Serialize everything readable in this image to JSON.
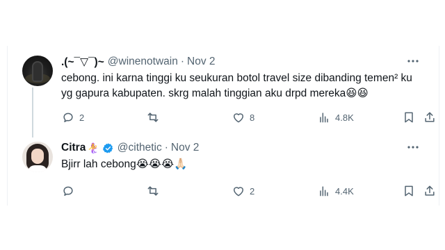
{
  "tweets": [
    {
      "display_name": ".(~¯▽¯)~",
      "handle": "@winenotwain",
      "separator": "·",
      "date": "Nov 2",
      "text": "cebong. ini karna tinggi ku seukuran botol travel size dibanding temen² ku\nyg gapura kabupaten. skrg malah tinggian aku drpd mereka😆😆",
      "replies": "2",
      "retweets": "",
      "likes": "8",
      "views": "4.8K"
    },
    {
      "display_name": "Citra",
      "name_emoji": "🧜‍♀️",
      "verified": true,
      "handle": "@cithetic",
      "separator": "·",
      "date": "Nov 2",
      "text": "Bjirr lah cebong😭😭😭🙏🏻",
      "replies": "",
      "retweets": "",
      "likes": "2",
      "views": "4.4K"
    }
  ],
  "colors": {
    "text": "#0f1419",
    "secondary": "#536471",
    "thread_line": "#cfd9de",
    "verified_blue": "#1d9bf0"
  },
  "icons": [
    "more-icon",
    "reply-icon",
    "retweet-icon",
    "like-icon",
    "views-icon",
    "bookmark-icon",
    "share-icon",
    "verified-icon"
  ]
}
